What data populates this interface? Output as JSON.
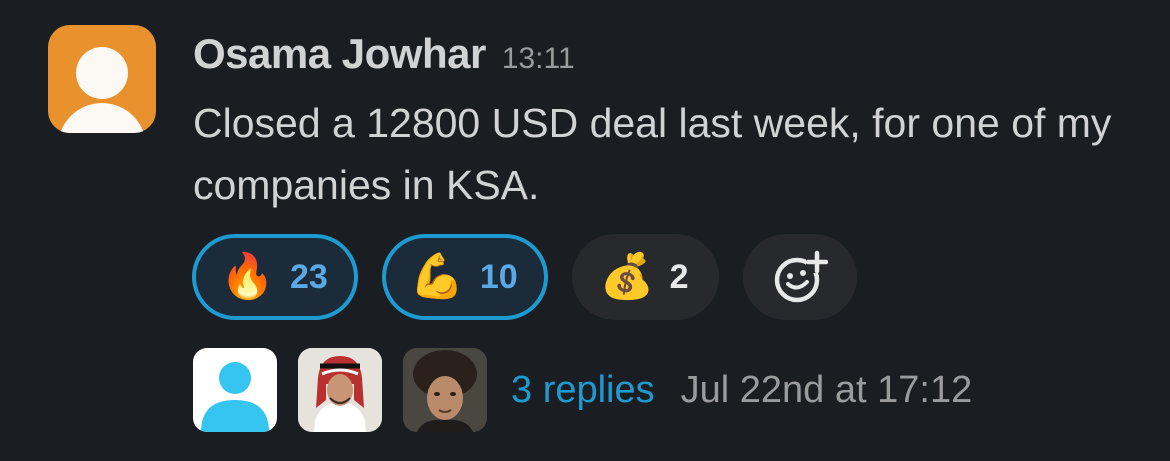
{
  "message": {
    "sender": "Osama Jowhar",
    "timestamp": "13:11",
    "text": "Closed a 12800 USD deal last week, for one of my companies in KSA.",
    "avatar_color": "#e8912d"
  },
  "reactions": [
    {
      "emoji": "🔥",
      "icon": "fire-icon",
      "count": "23",
      "active": true
    },
    {
      "emoji": "💪",
      "icon": "flexed-biceps-icon",
      "count": "10",
      "active": true
    },
    {
      "emoji": "💰",
      "icon": "money-bag-icon",
      "count": "2",
      "active": false
    }
  ],
  "add_reaction": {
    "icon": "add-reaction-icon"
  },
  "thread": {
    "reply_count_label": "3 replies",
    "last_reply": "Jul 22nd at 17:12",
    "participants": [
      "default-avatar",
      "photo-avatar",
      "photo-avatar"
    ]
  },
  "colors": {
    "background": "#1a1d21",
    "accent": "#1d9bd1",
    "text": "#d1d2d3",
    "muted": "#9a9b9d"
  }
}
